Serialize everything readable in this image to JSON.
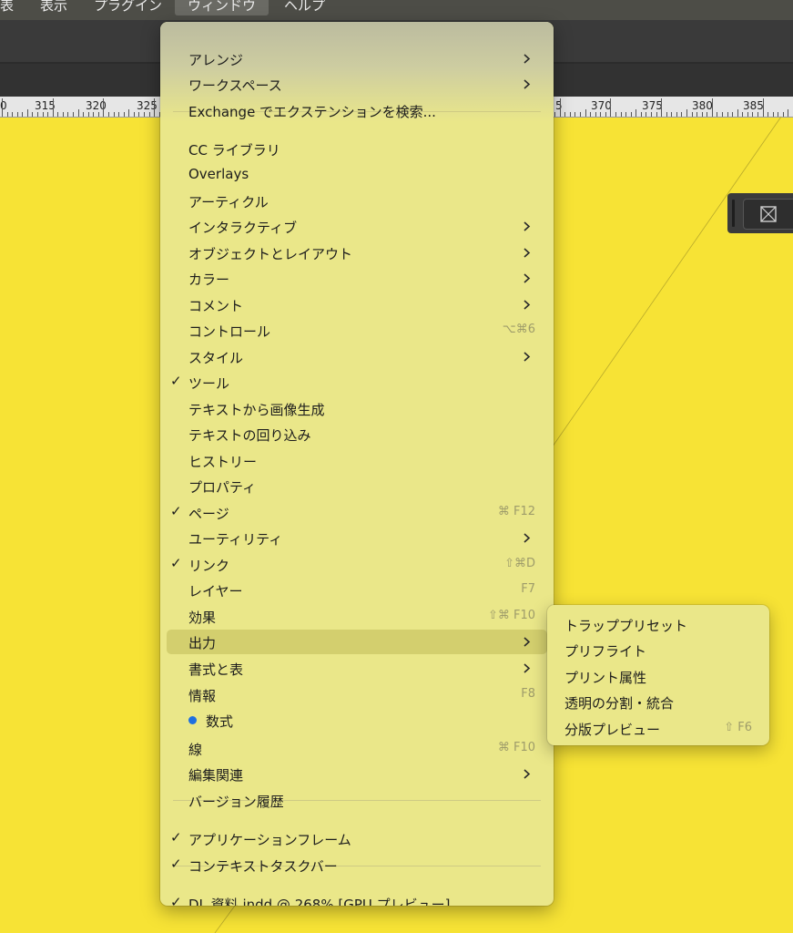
{
  "menubar": {
    "items": [
      "表",
      "表示",
      "プラグイン",
      "ウィンドウ",
      "ヘルプ"
    ]
  },
  "ruler": {
    "labels": [
      "0",
      "315",
      "320",
      "325",
      "5",
      "370",
      "375",
      "380",
      "385"
    ]
  },
  "colors": {
    "canvas": "#f7e335",
    "menu_bg": "#eae789",
    "highlight": "#d3cf6e",
    "shortcut": "#9e9c6a",
    "dot": "#1f6fe0"
  },
  "menu": {
    "items": [
      {
        "label": "アレンジ",
        "submenu": true
      },
      {
        "label": "ワークスペース",
        "submenu": true
      },
      {
        "label": "Exchange でエクステンションを検索..."
      },
      {
        "label": "CC ライブラリ"
      },
      {
        "label": "Overlays"
      },
      {
        "label": "アーティクル"
      },
      {
        "label": "インタラクティブ",
        "submenu": true
      },
      {
        "label": "オブジェクトとレイアウト",
        "submenu": true
      },
      {
        "label": "カラー",
        "submenu": true
      },
      {
        "label": "コメント",
        "submenu": true
      },
      {
        "label": "コントロール",
        "shortcut": "⌥⌘6"
      },
      {
        "label": "スタイル",
        "submenu": true
      },
      {
        "label": "ツール",
        "checked": true
      },
      {
        "label": "テキストから画像生成"
      },
      {
        "label": "テキストの回り込み"
      },
      {
        "label": "ヒストリー"
      },
      {
        "label": "プロパティ"
      },
      {
        "label": "ページ",
        "checked": true,
        "shortcut": "⌘ F12"
      },
      {
        "label": "ユーティリティ",
        "submenu": true
      },
      {
        "label": "リンク",
        "checked": true,
        "shortcut": "⇧⌘D"
      },
      {
        "label": "レイヤー",
        "shortcut": "F7"
      },
      {
        "label": "効果",
        "shortcut": "⇧⌘ F10"
      },
      {
        "label": "出力",
        "submenu": true,
        "highlighted": true
      },
      {
        "label": "書式と表",
        "submenu": true
      },
      {
        "label": "情報",
        "shortcut": "F8"
      },
      {
        "label": "数式",
        "dot": true
      },
      {
        "label": "線",
        "shortcut": "⌘ F10"
      },
      {
        "label": "編集関連",
        "submenu": true
      },
      {
        "label": "バージョン履歴"
      },
      {
        "label": "アプリケーションフレーム",
        "checked": true
      },
      {
        "label": "コンテキストタスクバー",
        "checked": true
      },
      {
        "label": "DL 資料.indd @ 268% [GPU プレビュー]",
        "checked": true
      }
    ]
  },
  "submenu": {
    "items": [
      {
        "label": "トラッププリセット"
      },
      {
        "label": "プリフライト"
      },
      {
        "label": "プリント属性"
      },
      {
        "label": "透明の分割・統合"
      },
      {
        "label": "分版プレビュー",
        "shortcut": "⇧ F6"
      }
    ]
  }
}
